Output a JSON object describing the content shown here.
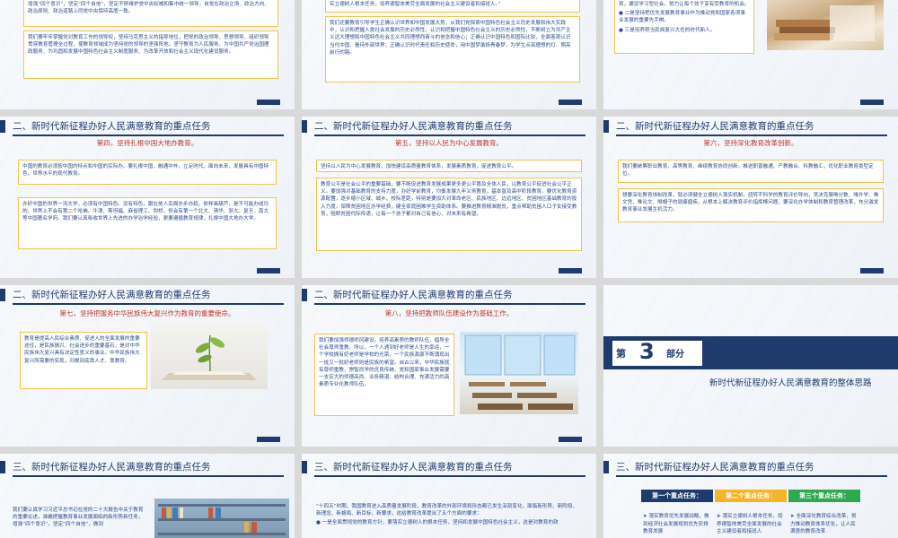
{
  "colors": {
    "navy": "#1f3b6e",
    "red": "#c0392b",
    "gold": "#f3c44a",
    "text": "#2b4d8a",
    "green": "#2fa84f"
  },
  "section_title": "二、新时代新征程办好人民满意教育的重点任务",
  "section3_title": "三、新时代新征程办好人民满意教育的重点任务",
  "row1": {
    "s1_text1": "增强“四个意识”，坚定“四个自信”，坚定不移维护党中央权威和集中统一领导，自觉在政治立场、政治方向、政治原则、政治道路上同党中央保持高度一致。",
    "s1_text2": "我们要牢牢掌握党对教育工作的领导权，坚持马克思主义的指导地位，把党的政治领导、思想领导、组织领导贯穿教育管理全过程，使教育领域成为坚持党的领导的坚强阵地。坚守教育为人民服务、为中国共产党治国理政服务、为巩固和发展中国特色社会主义制度服务、为改革开放和社会主义现代化建设服务。",
    "s2_text1": "实立德树人根本任务，培养德智体美劳全面发展的社会主义建设者和接班人。”",
    "s2_text2": "我们还要教育引导学生正确认识世界和中国发展大势，从我们党探索中国特色社会主义历史发展和伟大实践中，认识和把握人类社会发展的历史必然性，认识和把握中国特色社会主义的历史必然性，不断树立为共产主义远大理想和中国特色社会主义共同理想而奋斗的信念和信心；正确认识中国特色和国际比较，全面客观认识当代中国、看待外部世界；正确认识时代责任和历史使命，用中国梦激扬青春梦，为学生点亮理想的灯、照亮前行的路。",
    "s3_text1": "育，建设学习型社会，努力让每个孩子享有受教育的机会。",
    "s3_bullet2": "二是坚持把优先发展教育事业作为推动党和国家各项事业发展的重要先手棋。",
    "s3_bullet3": "三是培养担当民族复兴大任的时代新人。"
  },
  "row2": {
    "s1_sub": "第四，坚持扎根中国大地办教育。",
    "s1_box1": "中国的教育必须按中国的特点和中国的实际办。要扎根中国、融通中外，立足时代、面向未来，发展具有中国特色、世界水平的现代教育。",
    "s1_box2": "办好中国的世界一流大学，必须有中国特色。没有特色，跟在他人后面亦步亦趋，依样画葫芦，是不可能办成功的。世界上不会有第二个哈佛、牛津、斯坦福、麻省理工、剑桥，但会有第一个北大、清华、浙大、复旦、南大等中国著名学府。我们要认真吸收世界上先进的办学治学经验，更要遵循教育规律，扎根中国大地办大学。",
    "s2_sub": "第五，坚持以人民为中心发展教育。",
    "s2_box1": "坚持以人民为中心发展教育，加快建设高质量教育体系，发展素质教育，促进教育公平。",
    "s2_box2": "教育公平是社会公平的重要基础，要不断促进教育发展成果更多更公平惠及全体人民，以教育公平促进社会公平正义。要加强对基础教育的支持力度，办好学前教育，均衡发展九年义务教育，基本普及高中阶段教育。要优化教育资源配置，逐步缩小区域、城乡、校际差距，特别是要加大对革命老区、民族地区、边远地区、贫困地区基础教育的投入力度，保障贫困地区办学经费，健全家庭困难学生资助体系。要推进教育精准脱贫，重点帮助贫困人口子女接受教育，阻断贫困代际传递，让每一个孩子都对自己有信心、对未来有希望。",
    "s3_sub": "第六，坚持深化教育改革创新。",
    "s3_box1": "我们要统筹职业教育、高等教育、继续教育协同创新，推进职普融通、产教融合、科教融汇，优化职业教育类型定位。",
    "s3_box2": "想要深化教育体制改革，就必须健全立德树人落实机制，扭转不科学的教育评价导向，坚决克服唯分数、唯升学、唯文凭、唯论文、唯帽子的顽瘴痼疾，从根本上解决教育评价指挥棒问题，要深化办学体制和教育管理改革，充分激发教育事业发展生机活力。"
  },
  "row3": {
    "s1_sub": "第七，坚持把服务中华民族伟大复兴作为教育的重要使命。",
    "s1_box": "教育是提高人民综合素质、促进人的全面发展的重要途径，是民族振兴、社会进步的重要基石，是对中华民族伟大复兴具有决定性意义的事业。中华民族伟大复兴所需要的实现，归根到底靠人才、靠教育。",
    "s2_sub": "第八，坚持把教师队伍建设作为基础工作。",
    "s2_box": "我们要加强师德师风建设，培养高素质的教师队伍，倡导全社会尊师重教。所以，一个人遇到好老师是人生的幸运，一个学校拥有好老师是学校的光荣，一个民族源源不断涌现出一批又一批好老师则是民族的希望。自古以来，中华民族就有尊师重教、崇智尚学的优良传统。党和国家事业发展需要一支宏大的师德高尚、业务精湛、结构合理、充满活力的高素质专业化教师队伍。",
    "s3_di": "第",
    "s3_num": "3",
    "s3_bu": "部分",
    "s3_title": "新时代新征程办好人民满意教育的整体思路"
  },
  "row4": {
    "s1_text": "我们要认真学习习近平总书记在党的二十大报告中关于教育的重要论述，准确把握教育事业发展面临的新形势新任务，增强“四个意识”，坚定“四个自信”，做到",
    "s2_text1": "“十四五”时期，我国教育进入高质量发展阶段，教育改革的外部环境和形态都已发生深刻变化，面临新形势、新阶段、新理念、新格局、新目标、新要求，这给教育改革提出了五个方面的要求：",
    "s2_bullet": "一是全面贯彻党的教育方针，要落实立德树人的根本任务，坚持和发展中国特色社会主义，这是对教育的政",
    "s3_task1": "第一个重点任务：",
    "s3_task2": "第二个重点任务：",
    "s3_task3": "第三个重点任务：",
    "s3_body1": "➤ 落实教育优先发展战略，做到经济社会发展规划优先安排教育发展",
    "s3_body2": "➤ 落实立德树人根本任务，培养德智体美劳全面发展的社会主义建设者和接班人",
    "s3_body3": "➤ 全面深化教育综合改革，努力推动教育体系优化，让人民满意的教育改革"
  }
}
